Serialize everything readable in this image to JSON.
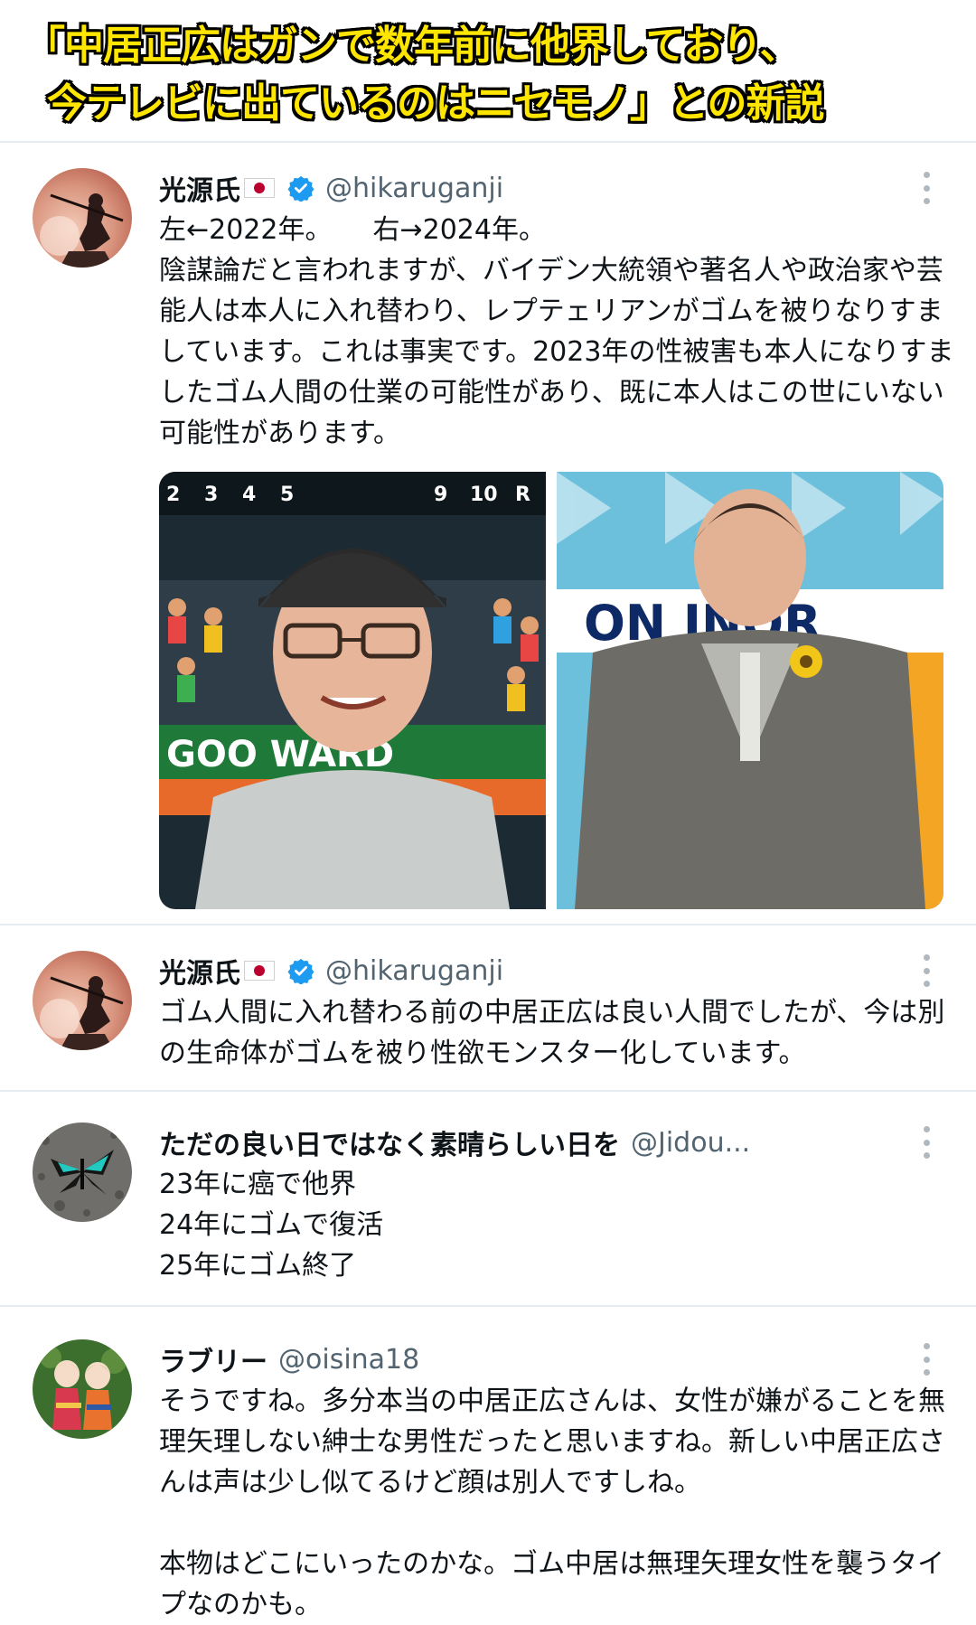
{
  "headline": {
    "line1": "「中居正広はガンで数年前に他界しており、",
    "line2": "今テレビに出ているのはニセモノ」との新説"
  },
  "tweets": [
    {
      "name": "光源氏",
      "handle": "@hikaruganji",
      "text": "左←2022年。　　右→2024年。\n陰謀論だと言われますが、バイデン大統領や著名人や政治家や芸能人は本人に入れ替わり、レプテェリアンがゴムを被りなりすましています。これは事実です。2023年の性被害も本人になりすましたゴム人間の仕業の可能性があり、既に本人はこの世にいない可能性があります。",
      "media": {
        "left_scoreboard": [
          "2",
          "3",
          "4",
          "5",
          "9",
          "10",
          "R"
        ],
        "left_banner": "GOO        WARD",
        "right_banner": "ON     INOR"
      }
    },
    {
      "name": "光源氏",
      "handle": "@hikaruganji",
      "text": "ゴム人間に入れ替わる前の中居正広は良い人間でしたが、今は別の生命体がゴムを被り性欲モンスター化しています。"
    },
    {
      "name": "ただの良い日ではなく素晴らしい日を",
      "handle": "@Jidou...",
      "text": "23年に癌で他界\n24年にゴムで復活\n25年にゴム終了"
    },
    {
      "name": "ラブリー",
      "handle": "@oisina18",
      "text": "そうですね。多分本当の中居正広さんは、女性が嫌がることを無理矢理しない紳士な男性だったと思いますね。新しい中居正広さんは声は少し似てるけど顔は別人ですしね。\n\n本物はどこにいったのかな。ゴム中居は無理矢理女性を襲うタイプなのかも。"
    }
  ],
  "colors": {
    "headline_fill": "#ffe600",
    "verified": "#1d9bf0",
    "handle": "#536471",
    "divider": "#e6ecf0"
  },
  "icons": [
    "japan-flag-icon",
    "verified-badge-icon",
    "more-options-icon"
  ]
}
